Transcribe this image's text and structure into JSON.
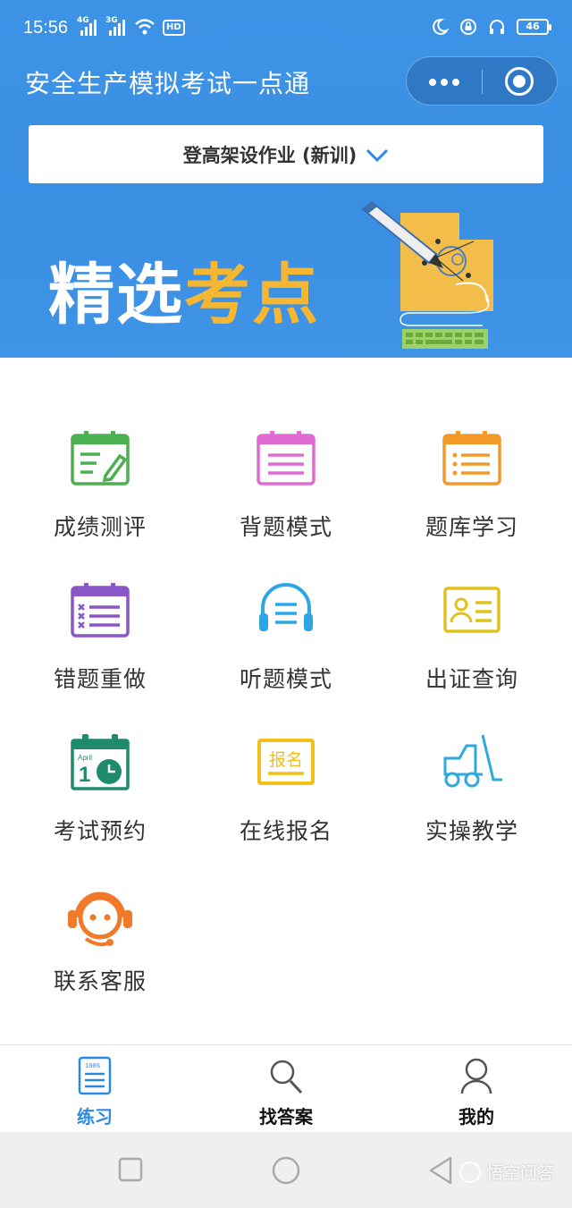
{
  "status_bar": {
    "time": "15:56",
    "net1": "4G",
    "net2": "3G",
    "hd": "HD",
    "battery": "46"
  },
  "header": {
    "title": "安全生产模拟考试一点通"
  },
  "category_select": {
    "value": "登高架设作业 (新训)"
  },
  "banner": {
    "heading_white": "精选",
    "heading_yellow": "考点"
  },
  "menu": [
    {
      "label": "成绩测评",
      "icon": "score-test-icon",
      "color": "#4caf50"
    },
    {
      "label": "背题模式",
      "icon": "memorize-icon",
      "color": "#e06cd3"
    },
    {
      "label": "题库学习",
      "icon": "question-bank-icon",
      "color": "#f39a2b"
    },
    {
      "label": "错题重做",
      "icon": "wrong-questions-icon",
      "color": "#8a56c8"
    },
    {
      "label": "听题模式",
      "icon": "headphones-icon",
      "color": "#2ea6e6"
    },
    {
      "label": "出证查询",
      "icon": "certificate-icon",
      "color": "#e0c21e"
    },
    {
      "label": "考试预约",
      "icon": "calendar-icon",
      "color": "#1f8a6c"
    },
    {
      "label": "在线报名",
      "icon": "register-icon",
      "color": "#f0c019"
    },
    {
      "label": "实操教学",
      "icon": "forklift-icon",
      "color": "#2da9de"
    },
    {
      "label": "联系客服",
      "icon": "customer-service-icon",
      "color": "#f07a2a"
    }
  ],
  "calendar_icon_text": {
    "month": "April",
    "day": "1"
  },
  "register_icon_text": "报名",
  "tabs": [
    {
      "label": "练习",
      "icon": "practice-icon",
      "active": true
    },
    {
      "label": "找答案",
      "icon": "search-icon",
      "active": false
    },
    {
      "label": "我的",
      "icon": "profile-icon",
      "active": false
    }
  ],
  "watermark": "悟空问答",
  "colors": {
    "header_blue": "#3a8fe3",
    "accent": "#2b8ae0",
    "banner_yellow": "#f5b731"
  }
}
